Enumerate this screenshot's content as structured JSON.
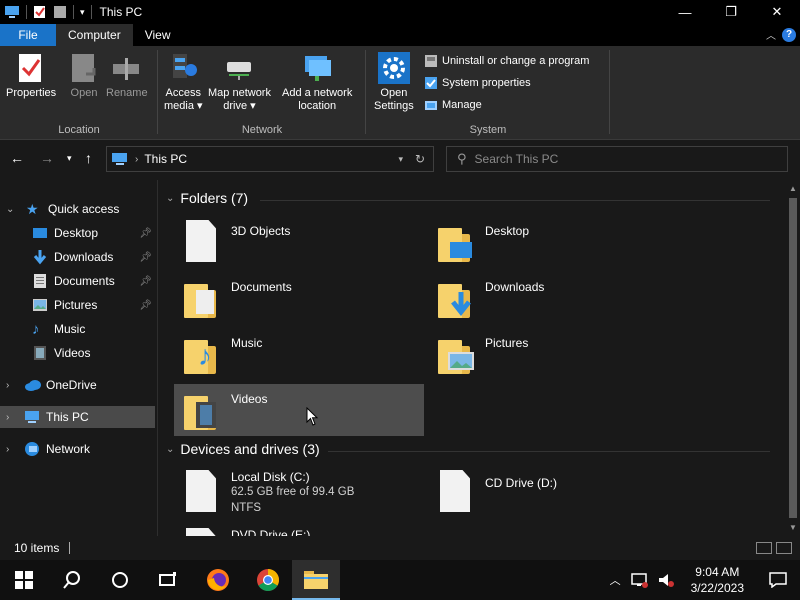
{
  "window": {
    "title": "This PC"
  },
  "tabs": {
    "file": "File",
    "computer": "Computer",
    "view": "View"
  },
  "ribbon": {
    "location": {
      "label": "Location",
      "properties": "Properties",
      "open": "Open",
      "rename": "Rename"
    },
    "network": {
      "label": "Network",
      "access_media": [
        "Access",
        "media ▾"
      ],
      "map_drive": [
        "Map network",
        "drive ▾"
      ],
      "add_location": [
        "Add a network",
        "location"
      ]
    },
    "system": {
      "label": "System",
      "open_settings": [
        "Open",
        "Settings"
      ],
      "uninstall": "Uninstall or change a program",
      "sys_props": "System properties",
      "manage": "Manage"
    }
  },
  "address": {
    "path": "This PC",
    "search_placeholder": "Search This PC"
  },
  "nav": {
    "quick_access": "Quick access",
    "items": [
      "Desktop",
      "Downloads",
      "Documents",
      "Pictures",
      "Music",
      "Videos"
    ],
    "onedrive": "OneDrive",
    "this_pc": "This PC",
    "network": "Network"
  },
  "folders": {
    "header": "Folders (7)",
    "items": [
      "3D Objects",
      "Desktop",
      "Documents",
      "Downloads",
      "Music",
      "Pictures",
      "Videos"
    ]
  },
  "drives": {
    "header": "Devices and drives (3)",
    "local": {
      "name": "Local Disk (C:)",
      "free": "62.5 GB free of 99.4 GB",
      "fs": "NTFS"
    },
    "cd": {
      "name": "CD Drive (D:)"
    },
    "dvd": {
      "name": "DVD Drive (E:)"
    }
  },
  "status": {
    "count": "10 items"
  },
  "clock": {
    "time": "9:04 AM",
    "date": "3/22/2023"
  },
  "colors": {
    "accent": "#1a73c8",
    "folder": "#f6d26c"
  }
}
